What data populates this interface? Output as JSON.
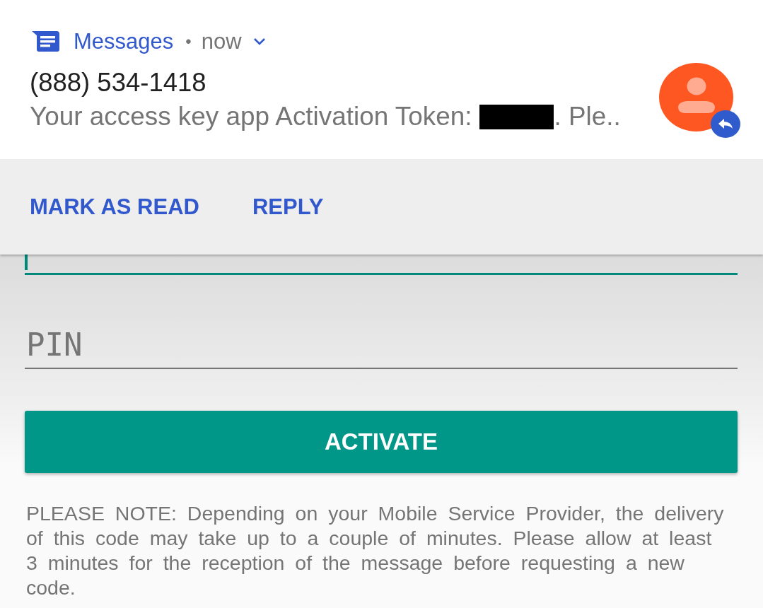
{
  "notification": {
    "app_name": "Messages",
    "separator": "•",
    "time": "now",
    "expanded": false,
    "sender": "(888) 534-1418",
    "message_start": "Your access key app Activation Token:",
    "token_redacted": true,
    "message_end": ". Ple..",
    "actions": [
      {
        "label": "MARK AS READ"
      },
      {
        "label": "REPLY"
      }
    ]
  },
  "form": {
    "fields": [
      {
        "focused": true
      },
      {
        "placeholder": "PIN",
        "focused": false
      }
    ],
    "activate_button": "ACTIVATE",
    "note": "PLEASE NOTE: Depending on your Mobile Service Provider, the delivery of this code may take up to a couple of minutes. Please allow at least 3 minutes for the reception of the message before requesting a new code."
  }
}
